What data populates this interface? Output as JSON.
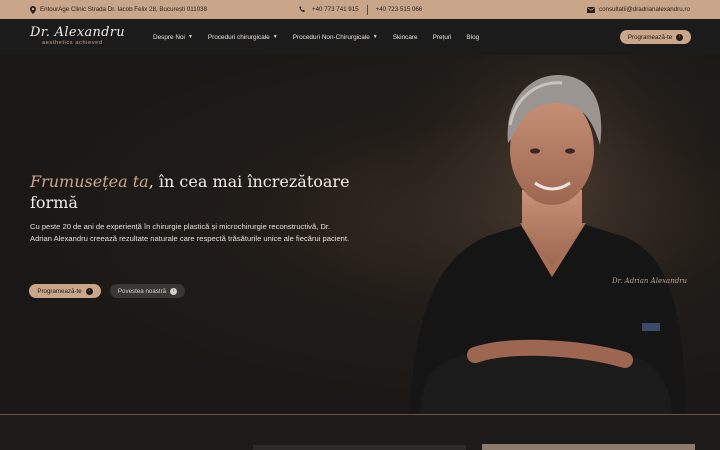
{
  "topbar": {
    "address": "EntourAge Clinic Strada Dr. Iacob Felix 28, București 011038",
    "phone1": "+40 773 741 915",
    "phone2": "+40 723 515 066",
    "email": "consultatii@dradrianalexandru.ro"
  },
  "header": {
    "logo_script": "Dr. Alexandru",
    "logo_tagline": "aesthetics achieved",
    "nav": [
      {
        "label": "Despre Noi",
        "has_dropdown": true
      },
      {
        "label": "Proceduri chirurgicale",
        "has_dropdown": true
      },
      {
        "label": "Proceduri Non-Chirurgicale",
        "has_dropdown": true
      },
      {
        "label": "Skincare",
        "has_dropdown": false
      },
      {
        "label": "Prețuri",
        "has_dropdown": false
      },
      {
        "label": "Blog",
        "has_dropdown": false
      }
    ],
    "cta_label": "Programează-te"
  },
  "hero": {
    "title_accent": "Frumusețea ta",
    "title_rest": ", în cea mai încrezătoare formă",
    "text": "Cu peste 20 de ani de experiență în chirurgie plastică și microchirurgie reconstructivă, Dr. Adrian Alexandru creează rezultate naturale care respectă trăsăturile unice ale fiecărui pacient.",
    "primary_button": "Programează-te",
    "secondary_button": "Povestea noastră",
    "scrub_label": "Dr. Adrian Alexandru"
  },
  "colors": {
    "accent": "#c9a68a",
    "background": "#1b1b1b",
    "text": "#f3ece6"
  },
  "icons": {
    "location": "map-pin-icon",
    "phone": "phone-icon",
    "email": "envelope-icon",
    "arrow": "arrow-right-circle-icon",
    "chevron": "chevron-down-icon"
  }
}
